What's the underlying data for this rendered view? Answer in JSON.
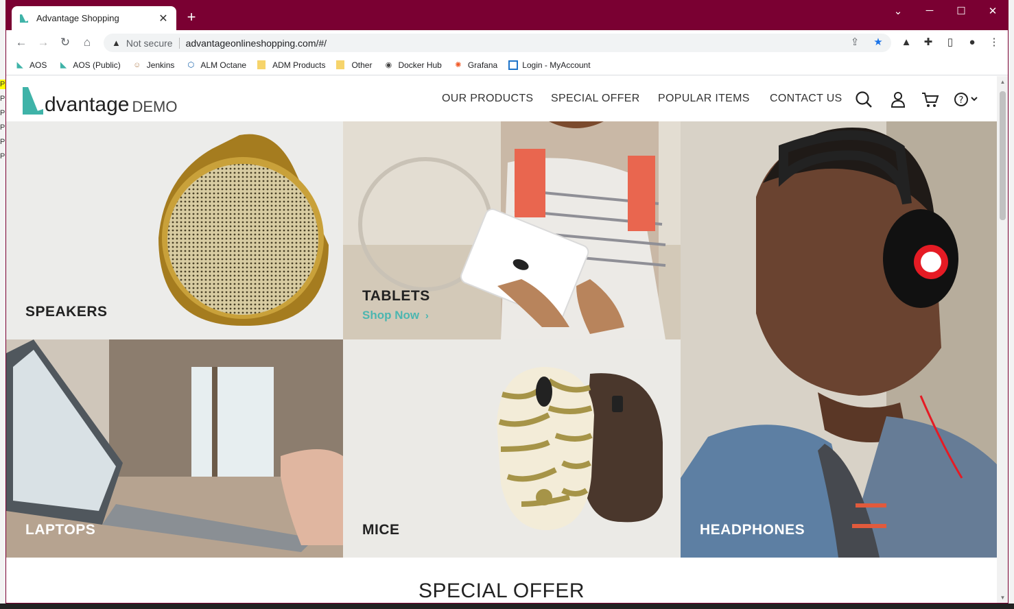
{
  "browser": {
    "tab_title": "Advantage Shopping",
    "address": {
      "security_label": "Not secure",
      "url": "advantageonlineshopping.com/#/"
    },
    "bookmarks": [
      {
        "label": "AOS",
        "icon": "aos-icon"
      },
      {
        "label": "AOS (Public)",
        "icon": "aos-icon"
      },
      {
        "label": "Jenkins",
        "icon": "jenkins-icon"
      },
      {
        "label": "ALM Octane",
        "icon": "octane-icon"
      },
      {
        "label": "ADM Products",
        "icon": "folder-icon"
      },
      {
        "label": "Other",
        "icon": "folder-icon"
      },
      {
        "label": "Docker Hub",
        "icon": "docker-icon"
      },
      {
        "label": "Grafana",
        "icon": "grafana-icon"
      },
      {
        "label": "Login - MyAccount",
        "icon": "login-icon"
      }
    ]
  },
  "site": {
    "logo_main": "dvantage",
    "logo_demo": "DEMO",
    "nav": [
      "OUR PRODUCTS",
      "SPECIAL OFFER",
      "POPULAR ITEMS",
      "CONTACT US"
    ],
    "categories": {
      "speakers": "SPEAKERS",
      "tablets": "TABLETS",
      "shop_now": "Shop Now",
      "laptops": "LAPTOPS",
      "mice": "MICE",
      "headphones": "HEADPHONES"
    },
    "special_offer_heading": "SPECIAL OFFER"
  },
  "colors": {
    "titlebar": "#7a0032",
    "accent": "#4cb6b0"
  }
}
